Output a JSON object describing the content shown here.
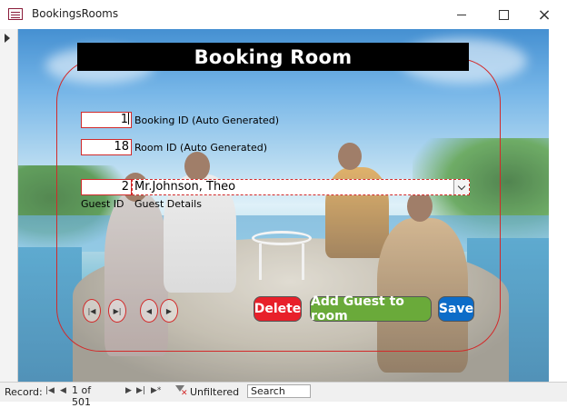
{
  "window": {
    "title": "BookingsRooms",
    "icon": "form-icon",
    "controls": {
      "minimize": "minimize-icon",
      "maximize": "maximize-icon",
      "close": "×"
    }
  },
  "form": {
    "title": "Booking Room",
    "booking_id": {
      "value": "1",
      "label": "Booking ID (Auto Generated)"
    },
    "room_id": {
      "value": "18",
      "label": "Room ID (Auto Generated)"
    },
    "guest_id": {
      "value": "2",
      "label": "Guest ID"
    },
    "guest_details": {
      "value": "Mr.Johnson, Theo",
      "label": "Guest Details"
    },
    "nav_buttons": {
      "first": "|◀",
      "last": "▶|",
      "previous": "◀",
      "next": "▶"
    },
    "buttons": {
      "delete": "Delete",
      "add_guest": "Add Guest to room",
      "save": "Save"
    },
    "colors": {
      "border": "#d22a2a",
      "delete_bg": "#e8202a",
      "add_bg": "#6aaa3a",
      "save_bg": "#0c6cc8"
    }
  },
  "record_bar": {
    "label": "Record:",
    "first": "|◀",
    "previous": "◀",
    "position": "1 of 501",
    "next": "▶",
    "last": "▶|",
    "new": "▶*",
    "filter_status": "Unfiltered",
    "search_placeholder": "Search"
  }
}
